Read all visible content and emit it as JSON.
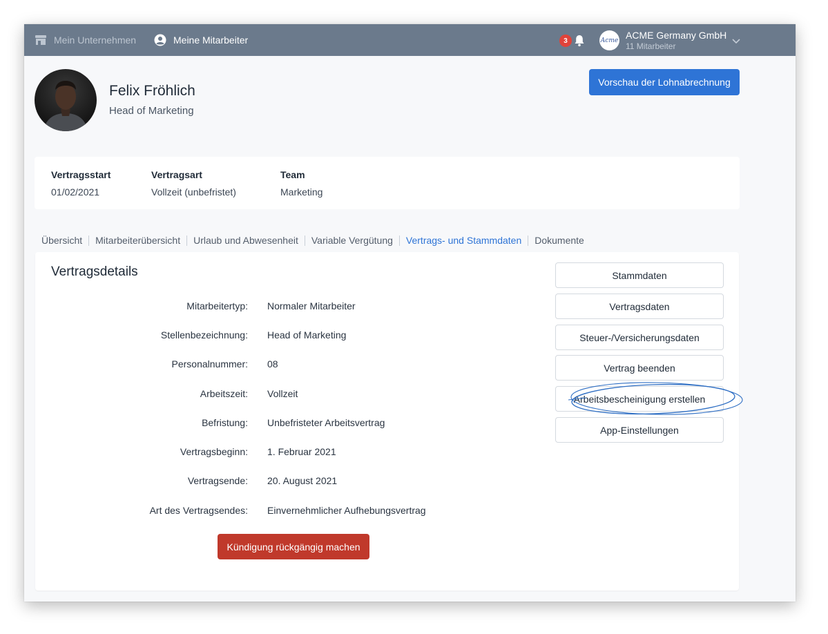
{
  "topbar": {
    "company_link": "Mein Unternehmen",
    "employees_link": "Meine Mitarbeiter",
    "notification_count": "3",
    "company_logo_text": "Acme",
    "company_name": "ACME Germany GmbH",
    "company_employee_count": "11 Mitarbeiter"
  },
  "employee": {
    "name": "Felix Fröhlich",
    "role": "Head of Marketing"
  },
  "preview_button": "Vorschau der Lohnabrechnung",
  "summary": [
    {
      "label": "Vertragsstart",
      "value": "01/02/2021"
    },
    {
      "label": "Vertragsart",
      "value": "Vollzeit (unbefristet)"
    },
    {
      "label": "Team",
      "value": "Marketing"
    }
  ],
  "tabs": [
    {
      "label": "Übersicht",
      "active": false
    },
    {
      "label": "Mitarbeiterübersicht",
      "active": false
    },
    {
      "label": "Urlaub und Abwesenheit",
      "active": false
    },
    {
      "label": "Variable Vergütung",
      "active": false
    },
    {
      "label": "Vertrags- und Stammdaten",
      "active": true
    },
    {
      "label": "Dokumente",
      "active": false
    }
  ],
  "details": {
    "title": "Vertragsdetails",
    "fields": [
      {
        "label": "Mitarbeitertyp:",
        "value": "Normaler Mitarbeiter"
      },
      {
        "label": "Stellenbezeichnung:",
        "value": "Head of Marketing"
      },
      {
        "label": "Personalnummer:",
        "value": "08"
      },
      {
        "label": "Arbeitszeit:",
        "value": "Vollzeit"
      },
      {
        "label": "Befristung:",
        "value": "Unbefristeter Arbeitsvertrag"
      },
      {
        "label": "Vertragsbeginn:",
        "value": "1. Februar 2021"
      },
      {
        "label": "Vertragsende:",
        "value": "20. August 2021"
      },
      {
        "label": "Art des Vertragsendes:",
        "value": "Einvernehmlicher Aufhebungsvertrag"
      }
    ],
    "undo_button": "Kündigung rückgängig machen"
  },
  "side_buttons": [
    "Stammdaten",
    "Vertragsdaten",
    "Steuer-/Versicherungsdaten",
    "Vertrag beenden",
    "Arbeitsbescheinigung erstellen",
    "App-Einstellungen"
  ],
  "colors": {
    "topbar": "#6b7a8c",
    "primary": "#2e74d6",
    "danger": "#c0392b",
    "badge": "#e0433a",
    "annotation": "#2f6fc4"
  }
}
